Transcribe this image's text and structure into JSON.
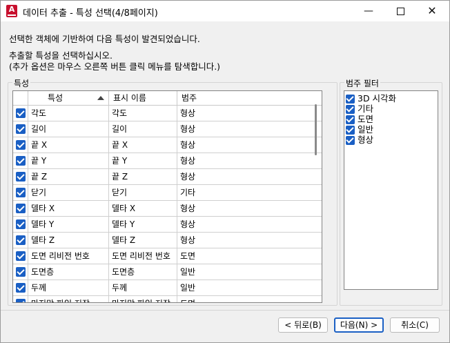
{
  "title": "데이터 추출 - 특성 선택(4/8페이지)",
  "window_controls": {
    "minimize": "—",
    "maximize": "",
    "close": "✕"
  },
  "app_icon_letter": "A",
  "instructions": {
    "line1": "선택한 객체에 기반하여 다음 특성이 발견되었습니다.",
    "line2": "추출할 특성을 선택하십시오.",
    "line3": "(추가 옵션은 마우스 오른쪽 버튼 클릭 메뉴를 탐색합니다.)"
  },
  "properties_group_label": "특성",
  "columns": {
    "property": "특성",
    "display_name": "표시 이름",
    "category": "범주"
  },
  "rows": [
    {
      "property": "각도",
      "display_name": "각도",
      "category": "형상",
      "checked": true
    },
    {
      "property": "길이",
      "display_name": "길이",
      "category": "형상",
      "checked": true
    },
    {
      "property": "끝 X",
      "display_name": "끝 X",
      "category": "형상",
      "checked": true
    },
    {
      "property": "끝 Y",
      "display_name": "끝 Y",
      "category": "형상",
      "checked": true
    },
    {
      "property": "끝 Z",
      "display_name": "끝 Z",
      "category": "형상",
      "checked": true
    },
    {
      "property": "닫기",
      "display_name": "닫기",
      "category": "기타",
      "checked": true
    },
    {
      "property": "델타 X",
      "display_name": "델타 X",
      "category": "형상",
      "checked": true
    },
    {
      "property": "델타 Y",
      "display_name": "델타 Y",
      "category": "형상",
      "checked": true
    },
    {
      "property": "델타 Z",
      "display_name": "델타 Z",
      "category": "형상",
      "checked": true
    },
    {
      "property": "도면 리비전 번호",
      "display_name": "도면 리비전 번호",
      "category": "도면",
      "checked": true
    },
    {
      "property": "도면층",
      "display_name": "도면층",
      "category": "일반",
      "checked": true
    },
    {
      "property": "두께",
      "display_name": "두께",
      "category": "일반",
      "checked": true
    },
    {
      "property": "마지막 파일 저장...",
      "display_name": "마지막 파일 저장...",
      "category": "도면",
      "checked": true
    }
  ],
  "category_filter": {
    "label": "범주 필터",
    "items": [
      {
        "label": "3D 시각화",
        "checked": true
      },
      {
        "label": "기타",
        "checked": true
      },
      {
        "label": "도면",
        "checked": true
      },
      {
        "label": "일반",
        "checked": true
      },
      {
        "label": "형상",
        "checked": true
      }
    ]
  },
  "buttons": {
    "back": "< 뒤로(B)",
    "next": "다음(N) >",
    "cancel": "취소(C)"
  },
  "colors": {
    "checkbox": "#1a5fc4",
    "primary_border": "#1a5fc4"
  }
}
